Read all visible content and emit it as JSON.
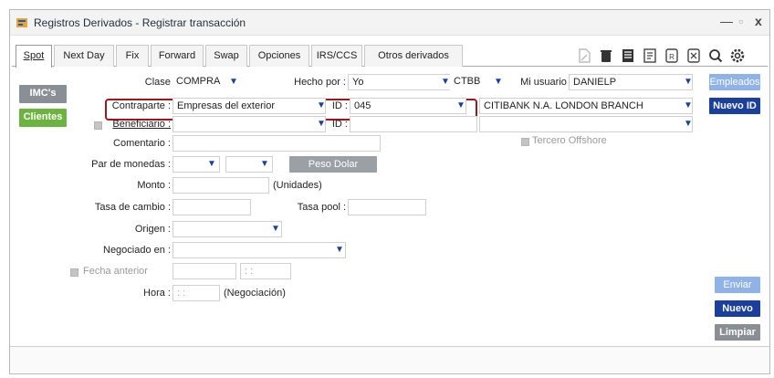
{
  "window": {
    "title": "Registros Derivados - Registrar transacción",
    "controls": [
      "—",
      "▫",
      "x"
    ]
  },
  "tabs": [
    {
      "label": "Spot"
    },
    {
      "label": "Next Day"
    },
    {
      "label": "Fix"
    },
    {
      "label": "Forward"
    },
    {
      "label": "Swap"
    },
    {
      "label": "Opciones"
    },
    {
      "label": "IRS/CCS"
    },
    {
      "label": "Otros derivados"
    }
  ],
  "toolbar_icons": [
    "doc-icon",
    "trash-icon",
    "list-icon",
    "grid-icon",
    "r-icon",
    "export-icon",
    "search-icon",
    "settings-icon"
  ],
  "side_buttons": {
    "imcs": "IMC's",
    "clientes": "Clientes"
  },
  "right_buttons": {
    "empleados": "Empleados",
    "nuevo_id": "Nuevo ID",
    "enviar": "Enviar",
    "nuevo": "Nuevo",
    "limpiar": "Limpiar"
  },
  "form": {
    "clase_label": "Clase :",
    "clase_value": "COMPRA",
    "hecho_por_label": "Hecho por :",
    "hecho_por_value": "Yo",
    "ctbb_value": "CTBB",
    "mi_usuario_label": "Mi usuario :",
    "mi_usuario_value": "DANIELP",
    "contraparte_label": "Contraparte :",
    "contraparte_value": "Empresas del exterior",
    "id_label": "ID :",
    "id_value": "045",
    "contraparte_nombre": "CITIBANK N.A. LONDON BRANCH",
    "beneficiario_label": "Beneficiario :",
    "id2_label": "ID :",
    "tercero_offshore": "Tercero Offshore",
    "comentario_label": "Comentario :",
    "par_monedas_label": "Par de monedas :",
    "peso_dolar": "Peso Dolar",
    "monto_label": "Monto :",
    "unidades": "(Unidades)",
    "tasa_cambio_label": "Tasa de cambio :",
    "tasa_pool_label": "Tasa pool :",
    "origen_label": "Origen :",
    "negociado_label": "Negociado en :",
    "fecha_anterior_label": "Fecha anterior",
    "hora_label": "Hora :",
    "negociacion": "(Negociación)",
    "time_placeholder": ": :"
  },
  "colors": {
    "accent_blue": "#1a3f9e",
    "light_blue": "#8fb3e8",
    "green": "#6db33f",
    "gray_btn": "#9aa0a6",
    "red_highlight": "#a3151d"
  }
}
